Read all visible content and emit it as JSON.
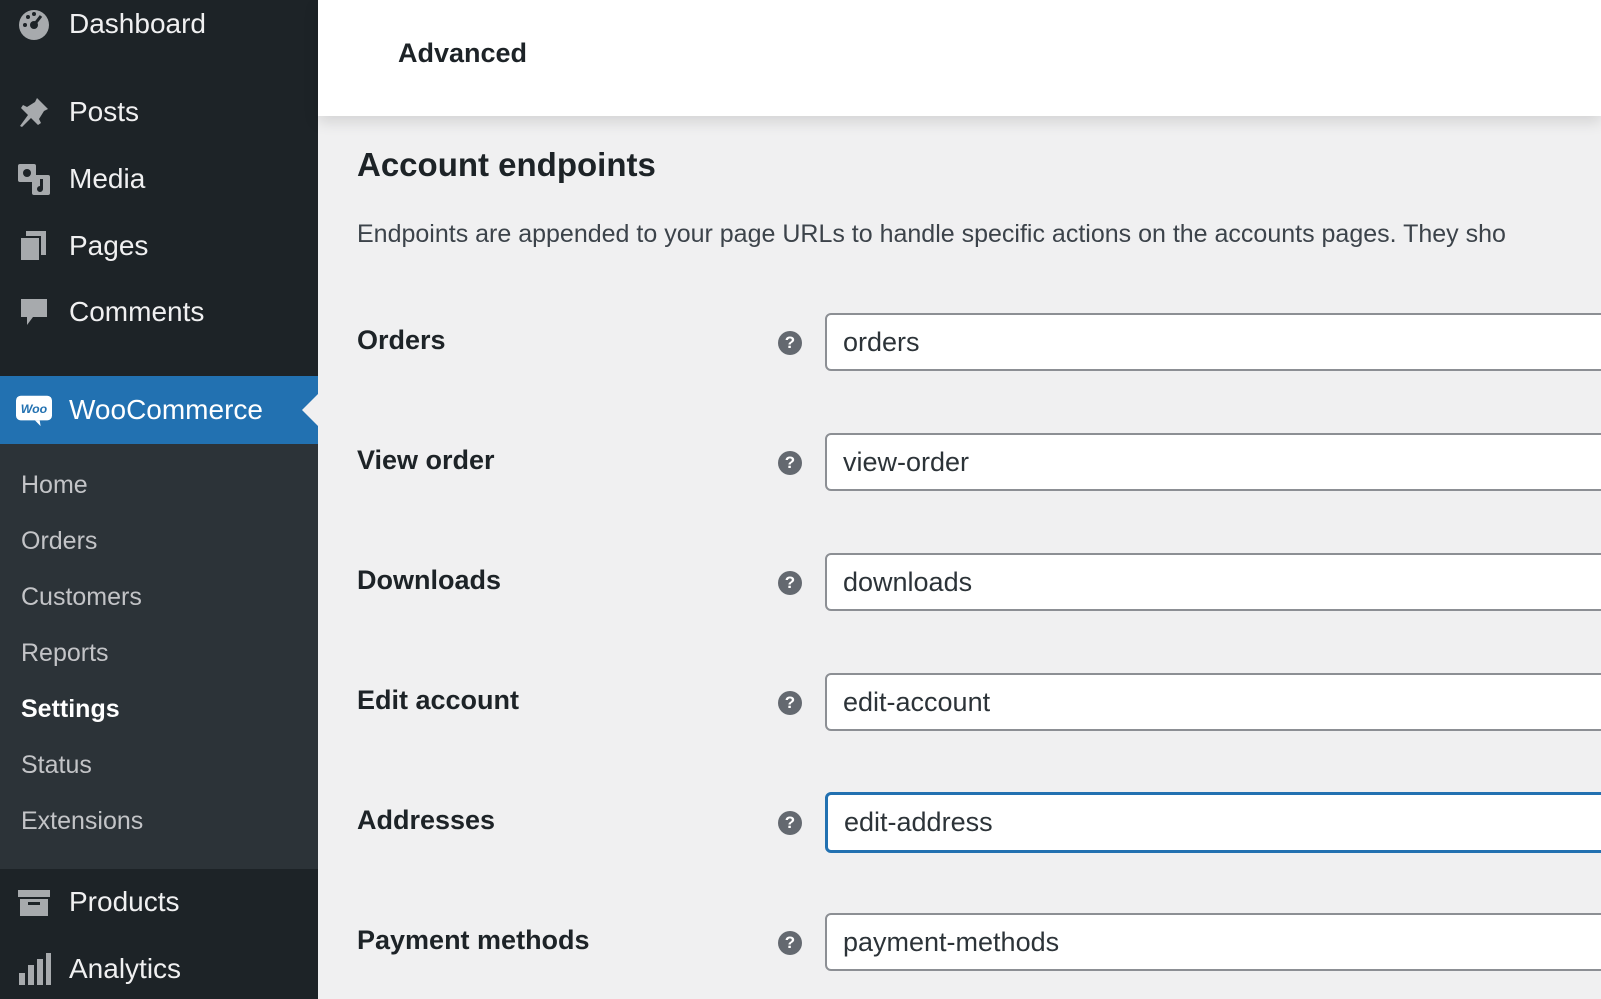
{
  "sidebar": {
    "top_items": [
      {
        "label": "Dashboard",
        "icon": "dashboard-icon"
      },
      {
        "label": "Posts",
        "icon": "pushpin-icon"
      },
      {
        "label": "Media",
        "icon": "media-icon"
      },
      {
        "label": "Pages",
        "icon": "pages-icon"
      },
      {
        "label": "Comments",
        "icon": "comment-icon"
      }
    ],
    "active_item": {
      "label": "WooCommerce",
      "icon": "woo-icon",
      "icon_text": "Woo"
    },
    "submenu": [
      "Home",
      "Orders",
      "Customers",
      "Reports",
      "Settings",
      "Status",
      "Extensions"
    ],
    "current_submenu": "Settings",
    "bottom_items": [
      {
        "label": "Products",
        "icon": "archive-icon"
      },
      {
        "label": "Analytics",
        "icon": "bar-chart-icon"
      }
    ]
  },
  "tabs": {
    "advanced_label": "Advanced"
  },
  "section": {
    "title": "Account endpoints",
    "description": "Endpoints are appended to your page URLs to handle specific actions on the accounts pages. They sho"
  },
  "fields": [
    {
      "label": "Orders",
      "value": "orders"
    },
    {
      "label": "View order",
      "value": "view-order"
    },
    {
      "label": "Downloads",
      "value": "downloads"
    },
    {
      "label": "Edit account",
      "value": "edit-account"
    },
    {
      "label": "Addresses",
      "value": "edit-address"
    },
    {
      "label": "Payment methods",
      "value": "payment-methods"
    }
  ],
  "help_glyph": "?",
  "colors": {
    "sidebar_bg": "#1d2327",
    "submenu_bg": "#2c3338",
    "accent": "#2271b1"
  }
}
